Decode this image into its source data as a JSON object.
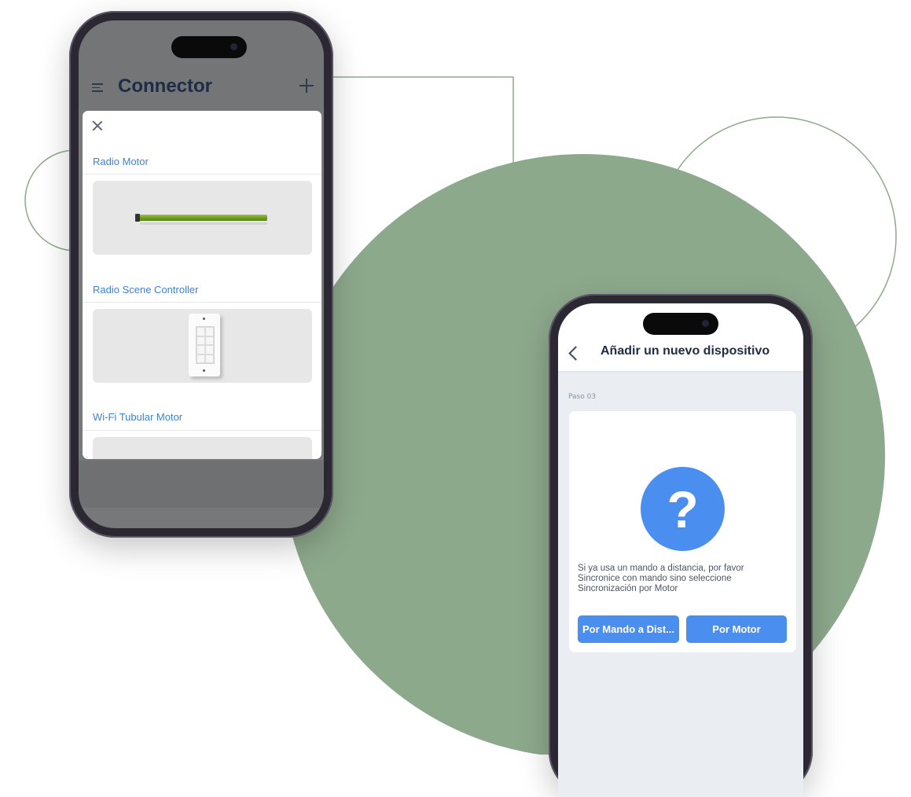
{
  "colors": {
    "accent": "#4a8ef0",
    "sage_green": "#8da98c",
    "title_navy": "#1f2c44",
    "label_blue": "#3d82d8"
  },
  "phone_left": {
    "header": {
      "menu_icon": "hamburger-icon",
      "title": "Connector",
      "add_icon": "plus-icon"
    },
    "sheet": {
      "close_icon": "close-icon",
      "devices": [
        {
          "label": "Radio Motor",
          "image": "tubular-motor"
        },
        {
          "label": "Radio Scene Controller",
          "image": "wall-switch"
        },
        {
          "label": "Wi-Fi Tubular Motor",
          "image": "tubular-motor"
        }
      ]
    }
  },
  "phone_right": {
    "header": {
      "back_icon": "chevron-left-icon",
      "title": "Añadir un nuevo dispositivo"
    },
    "step": "Paso 03",
    "card": {
      "icon": "question-icon",
      "icon_glyph": "?",
      "message_lines": [
        "Si ya usa un mando a distancia, por favor",
        "Sincronice con mando sino seleccione",
        "Sincronización por Motor"
      ],
      "buttons": {
        "remote": "Por Mando a Dist...",
        "motor": "Por Motor"
      }
    }
  }
}
